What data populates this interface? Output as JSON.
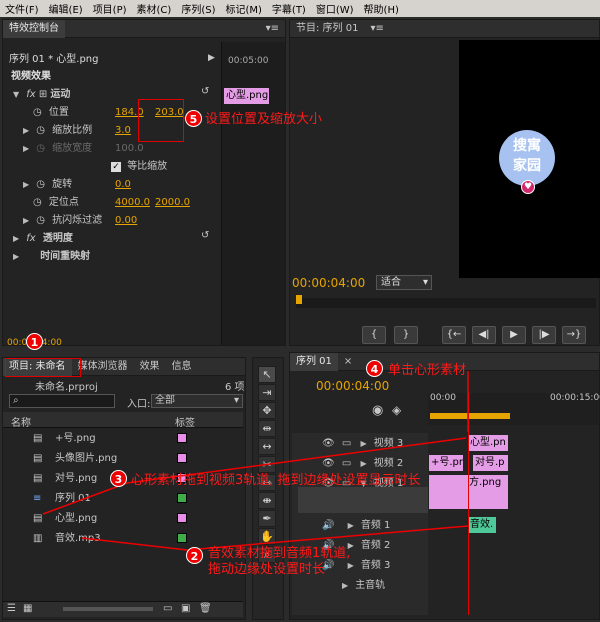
{
  "menu": [
    "文件(F)",
    "编辑(E)",
    "项目(P)",
    "素材(C)",
    "序列(S)",
    "标记(M)",
    "字幕(T)",
    "窗口(W)",
    "帮助(H)"
  ],
  "effects_panel": {
    "tab_label": "特效控制台",
    "seq_title": "序列 01 * 心型.png",
    "timecode_top": "00:05:00",
    "clip_label": "心型.png",
    "video_effects": "视频效果",
    "motion": "运动",
    "position_label": "位置",
    "position_x": "184.0",
    "position_y": "203.0",
    "scale_label": "缩放比例",
    "scale_value": "3.0",
    "scale_width_label": "缩放宽度",
    "scale_width_value": "100.0",
    "uniform_scale": "等比缩放",
    "rotation_label": "旋转",
    "rotation_value": "0.0",
    "anchor_label": "定位点",
    "anchor_x": "4000.0",
    "anchor_y": "2000.0",
    "antiflicker_label": "抗闪烁过滤",
    "antiflicker_value": "0.00",
    "opacity": "透明度",
    "time_remap": "时间重映射",
    "bottom_timecode": "00:00:04:00"
  },
  "program_monitor": {
    "tab_label": "节目: 序列 01",
    "timecode": "00:00:04:00",
    "fit_option": "适合",
    "logo_line1": "搜寓",
    "logo_line2": "家园"
  },
  "project_panel": {
    "tabs": [
      "项目: 未命名",
      "媒体浏览器",
      "效果",
      "信息"
    ],
    "project_file": "未命名.prproj",
    "item_count": "6 项",
    "search_placeholder": "",
    "in_label": "入口:",
    "in_option": "全部",
    "col_name": "名称",
    "col_label": "标签",
    "items": [
      {
        "name": "+号.png",
        "color": "#e88ee8"
      },
      {
        "name": "头像图片.png",
        "color": "#e88ee8"
      },
      {
        "name": "对号.png",
        "color": "#e88ee8"
      },
      {
        "name": "序列 01",
        "color": "#3fae49"
      },
      {
        "name": "心型.png",
        "color": "#e88ee8"
      },
      {
        "name": "音效.mp3",
        "color": "#3fae49"
      }
    ]
  },
  "timeline": {
    "tab_label": "序列 01",
    "timecode": "00:00:04:00",
    "ruler_start": "00:00",
    "ruler_end": "00:00:15:00",
    "tracks": [
      "视频 3",
      "视频 2",
      "视频 1",
      "音频 1",
      "音频 2",
      "音频 3",
      "主音轨"
    ],
    "clips": {
      "v3": "心型.pn",
      "v2a": "+号.pn",
      "v2b": "对号.p",
      "v1": "方.png",
      "a1": "音效."
    }
  },
  "annotations": {
    "n1": "1",
    "n2": "2",
    "n3": "3",
    "n4": "4",
    "n5": "5",
    "c2_line1": "音效素材拖到音频1轨道,",
    "c2_line2": "拖动边缘处设置时长",
    "c3": "心形素材拖到视频3轨道, 拖到边缘处设置显示时长",
    "c4": "单击心形素材",
    "c5": "设置位置及缩放大小"
  }
}
